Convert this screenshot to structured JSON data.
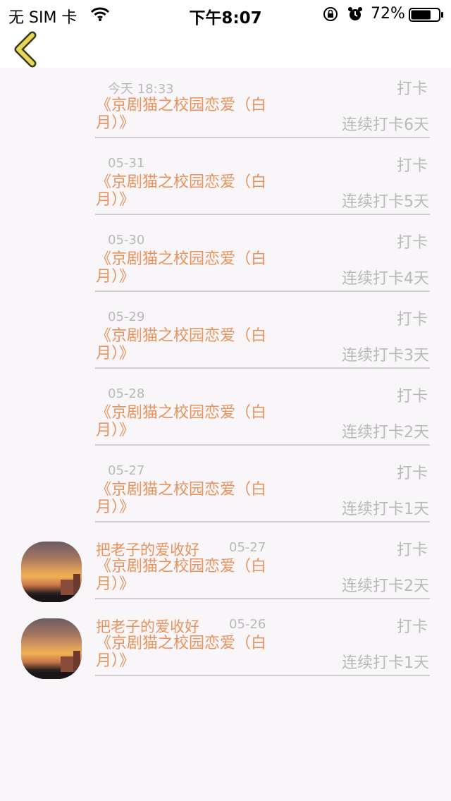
{
  "status_bar": {
    "carrier": "无 SIM 卡",
    "time": "下午8:07",
    "battery": "72%",
    "battery_level": 0.72
  },
  "nav": {
    "back_icon": "chevron-left-icon",
    "accent": "#e8d85a"
  },
  "colors": {
    "title": "#e8925c",
    "meta": "#b9b9b9",
    "background": "#f8f6f8"
  },
  "entries": [
    {
      "username": "",
      "date": "今天 18:33",
      "title": "《京剧猫之校园恋爱（白月）》",
      "action": "打卡",
      "streak": "连续打卡6天"
    },
    {
      "username": "",
      "date": "05-31",
      "title": "《京剧猫之校园恋爱（白月）》",
      "action": "打卡",
      "streak": "连续打卡5天"
    },
    {
      "username": "",
      "date": "05-30",
      "title": "《京剧猫之校园恋爱（白月）》",
      "action": "打卡",
      "streak": "连续打卡4天"
    },
    {
      "username": "",
      "date": "05-29",
      "title": "《京剧猫之校园恋爱（白月）》",
      "action": "打卡",
      "streak": "连续打卡3天"
    },
    {
      "username": "",
      "date": "05-28",
      "title": "《京剧猫之校园恋爱（白月）》",
      "action": "打卡",
      "streak": "连续打卡2天"
    },
    {
      "username": "",
      "date": "05-27",
      "title": "《京剧猫之校园恋爱（白月）》",
      "action": "打卡",
      "streak": "连续打卡1天"
    },
    {
      "username": "把老子的爱收好",
      "date": "05-27",
      "title": "《京剧猫之校园恋爱（白月）》",
      "action": "打卡",
      "streak": "连续打卡2天"
    },
    {
      "username": "把老子的爱收好",
      "date": "05-26",
      "title": "《京剧猫之校园恋爱（白月）》",
      "action": "打卡",
      "streak": "连续打卡1天"
    }
  ]
}
